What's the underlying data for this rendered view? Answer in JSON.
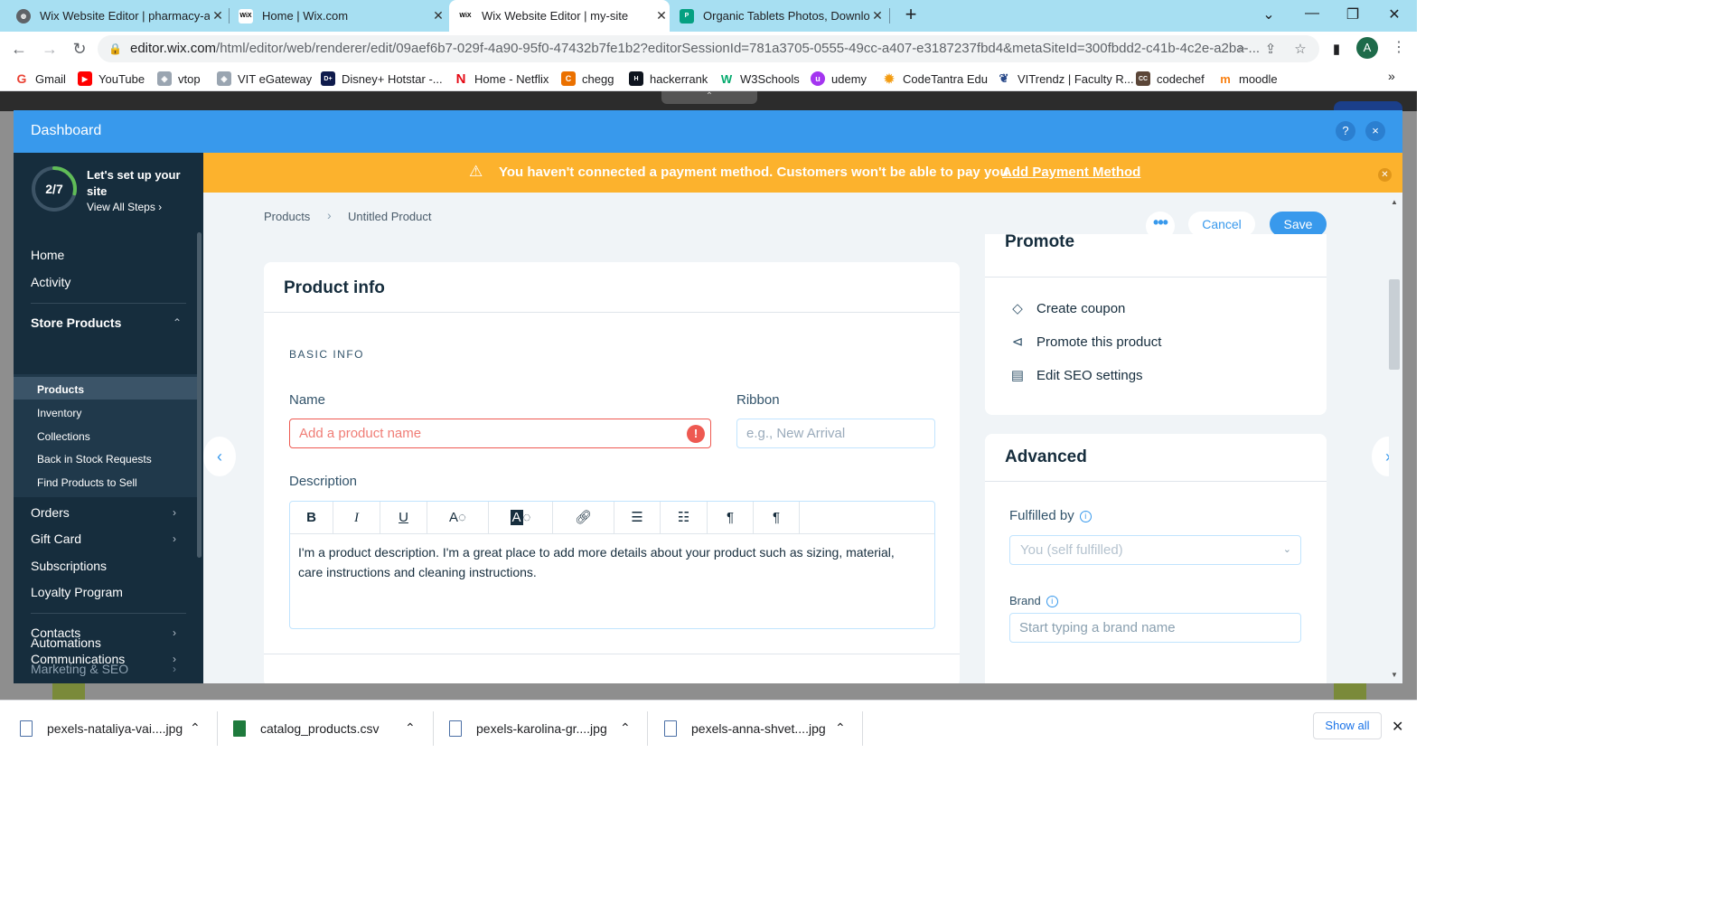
{
  "browser": {
    "tabs": [
      {
        "title": "Wix Website Editor | pharmacy-a",
        "favicon": "wix-globe-icon"
      },
      {
        "title": "Home | Wix.com",
        "favicon": "wix-icon"
      },
      {
        "title": "Wix Website Editor | my-site",
        "favicon": "wix-icon"
      },
      {
        "title": "Organic Tablets Photos, Downlo",
        "favicon": "pexels-icon"
      }
    ],
    "url_main": "editor.wix.com",
    "url_rest": "/html/editor/web/renderer/edit/09aef6b7-029f-4a90-95f0-47432b7fe1b2?editorSessionId=781a3705-0555-49cc-a407-e3187237fbd4&metaSiteId=300fbdd2-c41b-4c2e-a2ba-...",
    "avatar_letter": "A",
    "bookmarks": [
      "Gmail",
      "YouTube",
      "vtop",
      "VIT eGateway",
      "Disney+ Hotstar -...",
      "Home - Netflix",
      "chegg",
      "hackerrank",
      "W3Schools",
      "udemy",
      "CodeTantra Edu",
      "VITrendz | Faculty R...",
      "codechef",
      "moodle"
    ]
  },
  "dashboard": {
    "title": "Dashboard",
    "help_label": "?",
    "close_label": "×",
    "setup": {
      "progress_text": "2/7",
      "progress_fraction": 0.2857,
      "title": "Let's set up your site",
      "link": "View All Steps"
    },
    "nav": {
      "home": "Home",
      "activity": "Activity",
      "store_products": "Store Products",
      "sub": [
        "Products",
        "Inventory",
        "Collections",
        "Back in Stock Requests",
        "Find Products to Sell"
      ],
      "orders": "Orders",
      "gift_card": "Gift Card",
      "subscriptions": "Subscriptions",
      "loyalty": "Loyalty Program",
      "contacts": "Contacts",
      "communications": "Communications",
      "automations": "Automations",
      "marketing": "Marketing & SEO"
    },
    "banner": {
      "text": "You haven't connected a payment method. Customers won't be able to pay you.",
      "link": "Add Payment Method"
    },
    "breadcrumb": {
      "root": "Products",
      "current": "Untitled Product"
    },
    "actions": {
      "more": "•••",
      "cancel": "Cancel",
      "save": "Save"
    },
    "product_info": {
      "title": "Product info",
      "section": "BASIC INFO",
      "name_label": "Name",
      "name_placeholder": "Add a product name",
      "ribbon_label": "Ribbon",
      "ribbon_placeholder": "e.g., New Arrival",
      "description_label": "Description",
      "description_text": "I'm a product description. I'm a great place to add more details about your product such as sizing, material, care instructions and cleaning instructions."
    },
    "promote": {
      "title": "Promote",
      "items": [
        "Create coupon",
        "Promote this product",
        "Edit SEO settings"
      ]
    },
    "advanced": {
      "title": "Advanced",
      "fulfilled_label": "Fulfilled by",
      "fulfilled_value": "You (self fulfilled)",
      "brand_label": "Brand",
      "brand_placeholder": "Start typing a brand name"
    }
  },
  "downloads": {
    "files": [
      "pexels-nataliya-vai....jpg",
      "catalog_products.csv",
      "pexels-karolina-gr....jpg",
      "pexels-anna-shvet....jpg"
    ],
    "show_all": "Show all"
  },
  "colors": {
    "wix_blue": "#3899ec",
    "sidebar": "#162d3d",
    "banner": "#fcb22d",
    "error": "#ee5951",
    "tabstrip": "#a7dff2"
  }
}
